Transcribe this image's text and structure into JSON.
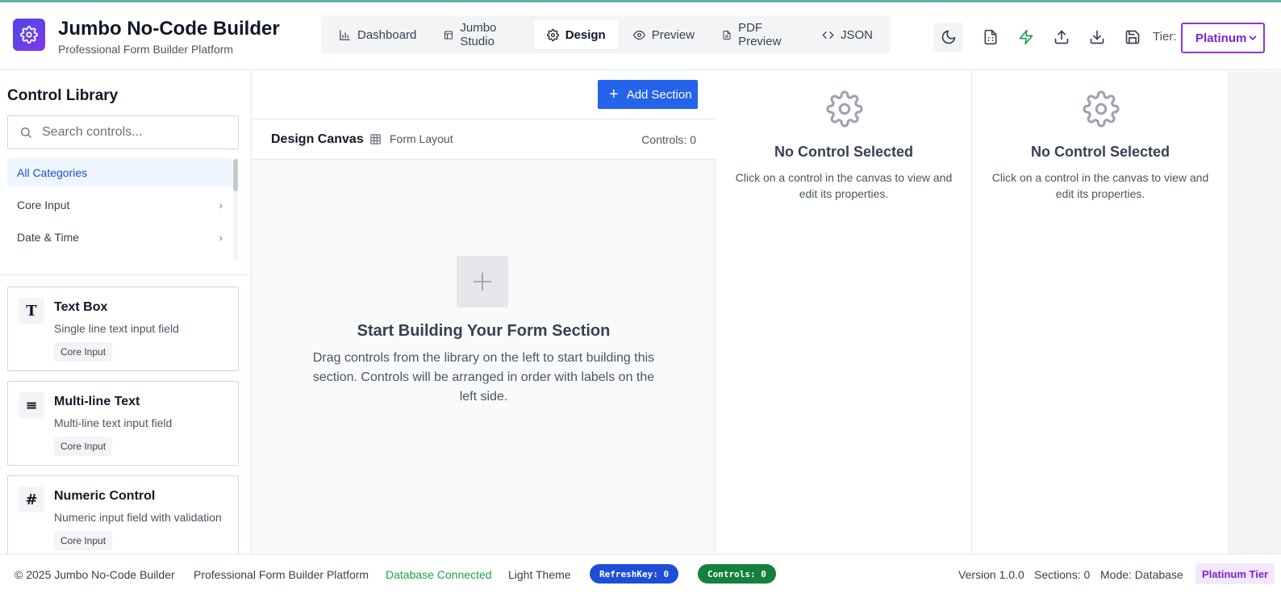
{
  "header": {
    "logo_icon": "gear-icon",
    "title": "Jumbo No-Code Builder",
    "subtitle": "Professional Form Builder Platform",
    "tabs": [
      {
        "label": "Dashboard",
        "icon": "bar-chart-icon"
      },
      {
        "label": "Jumbo Studio",
        "icon": "layout-icon"
      },
      {
        "label": "Design",
        "icon": "gear-icon",
        "active": true
      },
      {
        "label": "Preview",
        "icon": "eye-icon"
      },
      {
        "label": "PDF Preview",
        "icon": "file-icon"
      },
      {
        "label": "JSON",
        "icon": "code-icon"
      }
    ],
    "tools": [
      "moon-icon",
      "spreadsheet-icon",
      "zap-icon",
      "upload-icon",
      "download-icon",
      "save-icon"
    ],
    "tier_label": "Tier:",
    "tier_value": "Platinum"
  },
  "sidebar": {
    "title": "Control Library",
    "search_placeholder": "Search controls...",
    "categories": [
      {
        "label": "All Categories",
        "active": true
      },
      {
        "label": "Core Input",
        "arrow": "›"
      },
      {
        "label": "Date & Time",
        "arrow": "›"
      }
    ],
    "controls": [
      {
        "icon": "T",
        "name": "Text Box",
        "description": "Single line text input field",
        "tag": "Core Input"
      },
      {
        "icon": "≡",
        "name": "Multi-line Text",
        "description": "Multi-line text input field",
        "tag": "Core Input"
      },
      {
        "icon": "#",
        "name": "Numeric Control",
        "description": "Numeric input field with validation",
        "tag": "Core Input"
      }
    ]
  },
  "canvas": {
    "add_section_label": "Add Section",
    "title": "Design Canvas",
    "layout_label": "Form Layout",
    "controls_count": "Controls: 0",
    "empty_title": "Start Building Your Form Section",
    "empty_description": "Drag controls from the library on the left to start building this section. Controls will be arranged in order with labels on the left side."
  },
  "properties": [
    {
      "title": "No Control Selected",
      "description": "Click on a control in the canvas to view and edit its properties."
    },
    {
      "title": "No Control Selected",
      "description": "Click on a control in the canvas to view and edit its properties."
    }
  ],
  "footer": {
    "copyright": "© 2025 Jumbo No-Code Builder",
    "platform": "Professional Form Builder Platform",
    "db_status": "Database Connected",
    "theme": "Light Theme",
    "refresh_key": "RefreshKey: 0",
    "controls": "Controls: 0",
    "version": "Version 1.0.0",
    "sections": "Sections: 0",
    "mode": "Mode: Database",
    "tier_badge": "Platinum Tier"
  },
  "colors": {
    "accent": "#2563eb",
    "brand": "#6d28d9",
    "success": "#16a34a",
    "tier": "#9333ea"
  }
}
